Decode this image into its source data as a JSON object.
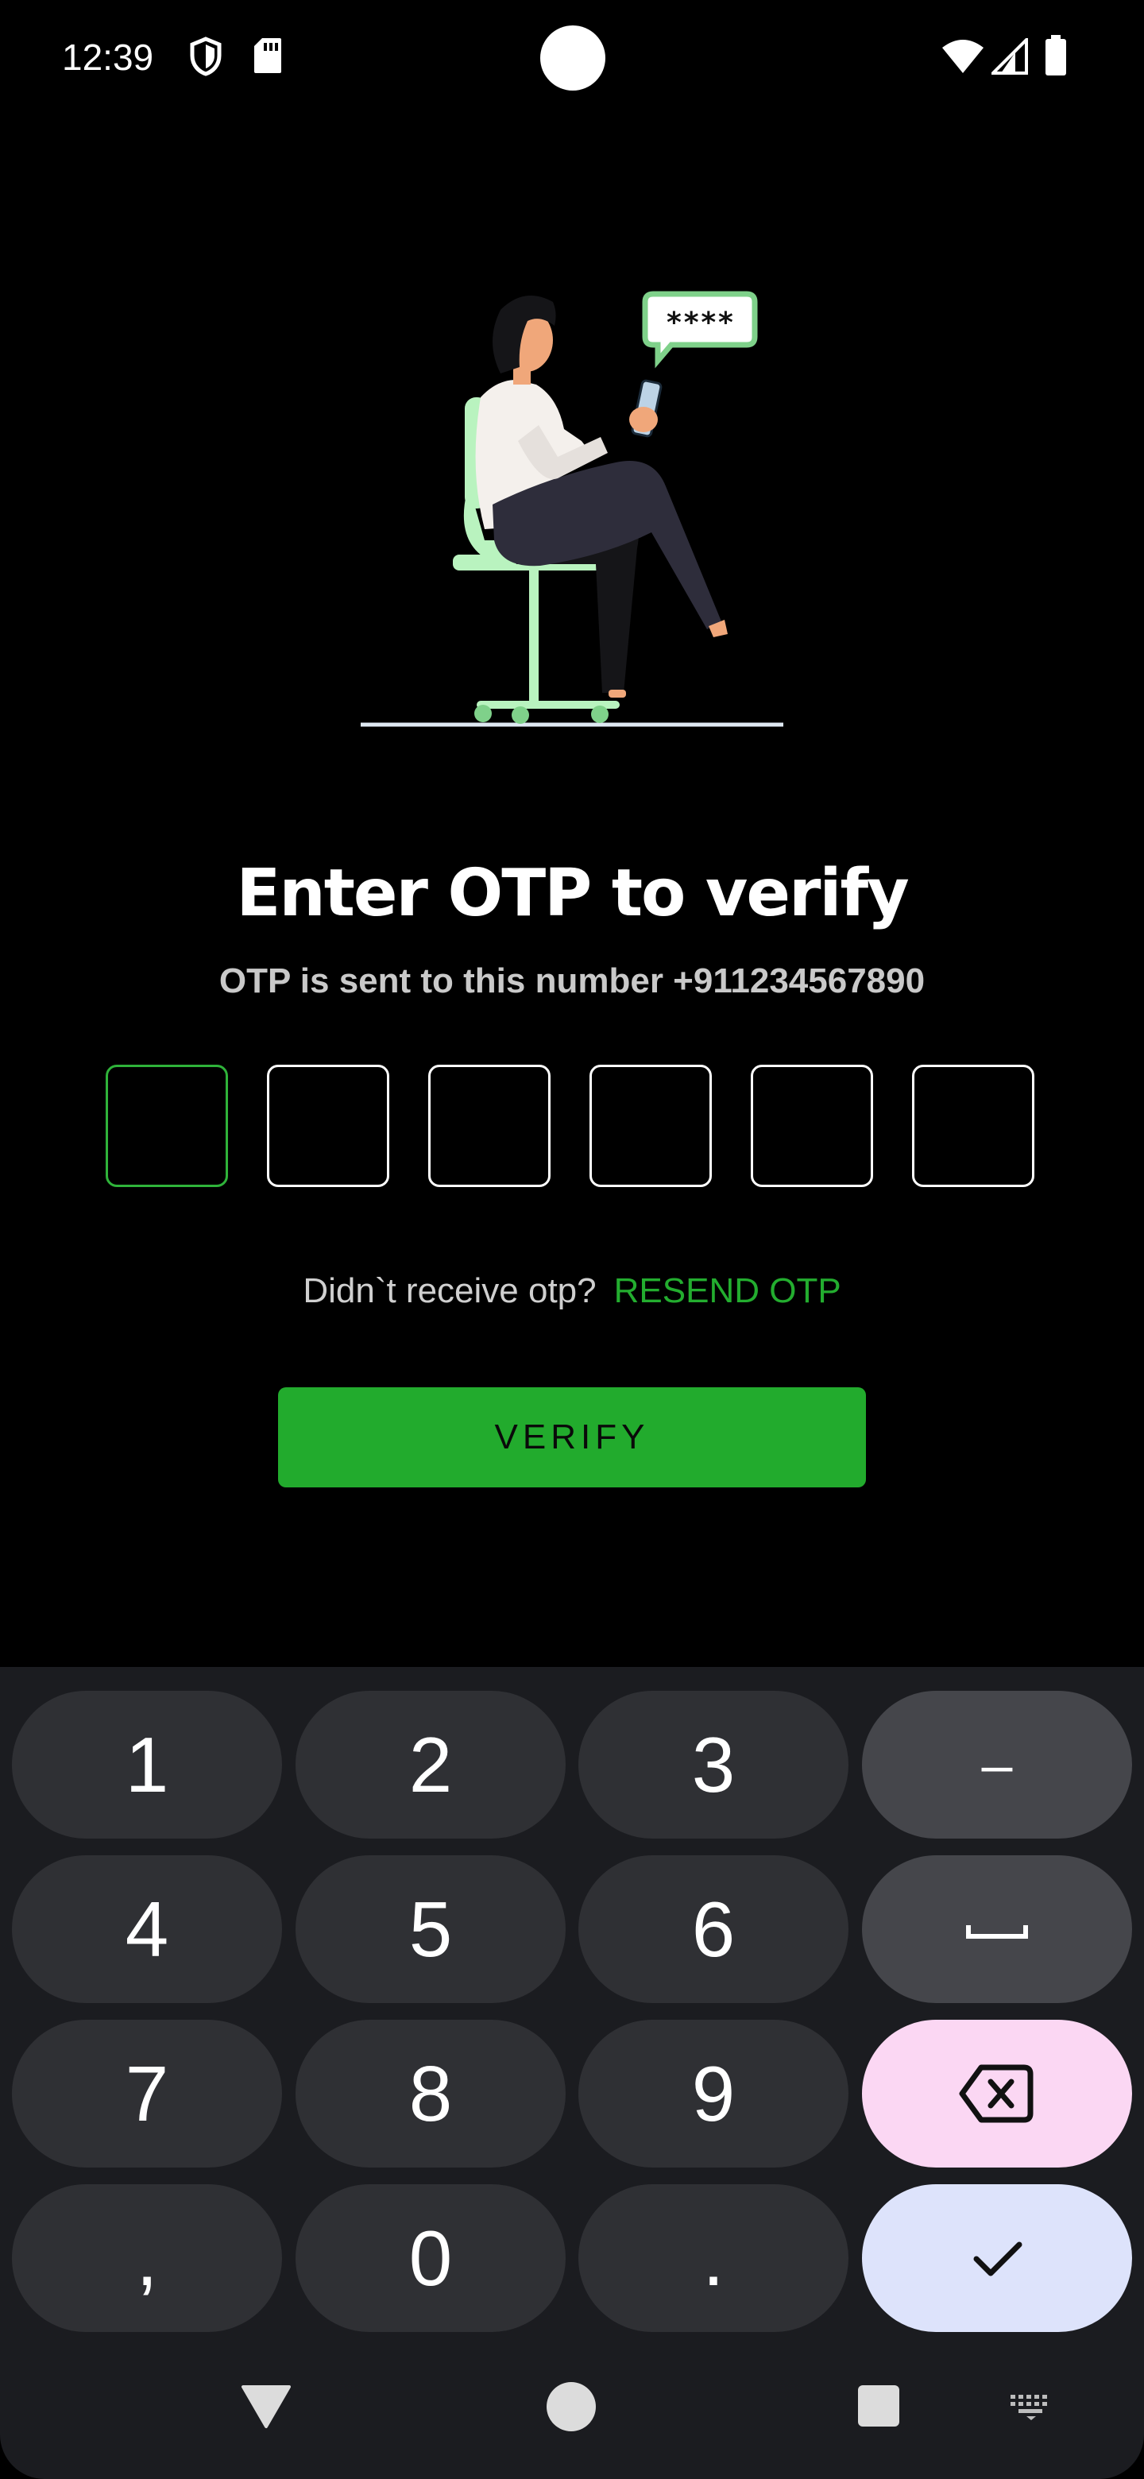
{
  "status_bar": {
    "time": "12:39",
    "icons": [
      "shield-icon",
      "sd-card-icon",
      "wifi-icon",
      "signal-icon",
      "battery-icon"
    ]
  },
  "illustration": {
    "bubble_text": "****"
  },
  "page": {
    "title": "Enter OTP to verify",
    "subtitle": "OTP is sent to this number +911234567890"
  },
  "otp": {
    "length": 6,
    "digits": [
      "",
      "",
      "",
      "",
      "",
      ""
    ],
    "active_index": 0
  },
  "resend": {
    "question": "Didn`t receive otp?",
    "link": "RESEND OTP"
  },
  "verify_button": {
    "label": "VERIFY"
  },
  "keyboard": {
    "rows": [
      [
        "1",
        "2",
        "3",
        "–"
      ],
      [
        "4",
        "5",
        "6",
        "space"
      ],
      [
        "7",
        "8",
        "9",
        "backspace"
      ],
      [
        ",",
        "0",
        ".",
        "done"
      ]
    ],
    "labels": {
      "k1": "1",
      "k2": "2",
      "k3": "3",
      "k4": "4",
      "k5": "5",
      "k6": "6",
      "k7": "7",
      "k8": "8",
      "k9": "9",
      "k0": "0",
      "dash": "–",
      "comma": ",",
      "period": "."
    }
  },
  "nav_bar": {
    "buttons": [
      "back-icon",
      "home-icon",
      "recents-icon",
      "keyboard-switch-icon"
    ]
  },
  "colors": {
    "accent": "#22ab2d",
    "background": "#000000",
    "keyboard_bg": "#1b1c20",
    "backspace_key": "#fbd7f3",
    "done_key": "#dde3fb"
  }
}
